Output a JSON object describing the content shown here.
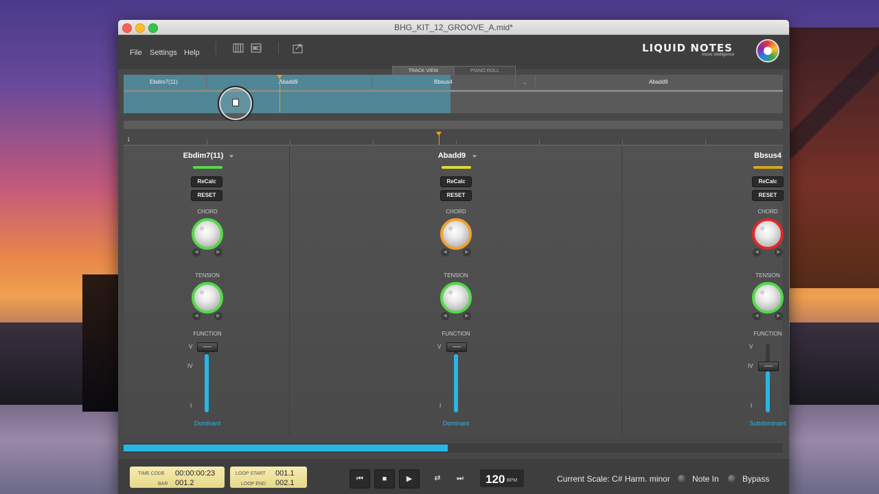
{
  "window": {
    "title": "BHG_KIT_12_GROOVE_A.mid*"
  },
  "menu": {
    "file": "File",
    "settings": "Settings",
    "help": "Help"
  },
  "toolbar": {
    "icons": [
      "piano-icon",
      "grid-icon",
      "export-icon"
    ]
  },
  "logo": {
    "name": "LIQUID NOTES",
    "tagline": "music intelligence"
  },
  "tabs": {
    "track_view": "TRACK VIEW",
    "piano_roll": "PIANO ROLL"
  },
  "track": {
    "segments": [
      "Ebdim7(11)",
      "Abadd9",
      "Bbsus4",
      "..",
      "Abadd9"
    ]
  },
  "ruler": {
    "start": "1"
  },
  "channels": [
    {
      "name": "Ebdim7(11)",
      "recalc": "ReCalc",
      "reset": "RESET",
      "chord_label": "CHORD",
      "tension_label": "TENSION",
      "function_label": "FUNCTION",
      "function": "Dominant",
      "fader_level": 0.85,
      "chord_color": "#55d84a",
      "tension_color": "#55d84a",
      "bar_color": "#55d84a"
    },
    {
      "name": "Abadd9",
      "recalc": "ReCalc",
      "reset": "RESET",
      "chord_label": "CHORD",
      "tension_label": "TENSION",
      "function_label": "FUNCTION",
      "function": "Dominant",
      "fader_level": 0.85,
      "chord_color": "#f0a030",
      "tension_color": "#55d84a",
      "bar_color": "#d8e030"
    },
    {
      "name": "Bbsus4",
      "recalc": "ReCalc",
      "reset": "RESET",
      "chord_label": "CHORD",
      "tension_label": "TENSION",
      "function_label": "FUNCTION",
      "function": "Subdominant",
      "fader_level": 0.6,
      "chord_color": "#e02828",
      "tension_color": "#55d84a",
      "bar_color": "#d0a820"
    }
  ],
  "roman": {
    "v": "V",
    "iv": "IV",
    "i": "I"
  },
  "playback_progress": 0.49,
  "transport": {
    "time_code_label": "TIME CODE",
    "time_code": "00:00:00:23",
    "bar_label": "BAR",
    "bar": "001.2",
    "loop_start_label": "LOOP START",
    "loop_start": "001.1",
    "loop_end_label": "LOOP END",
    "loop_end": "002.1",
    "bpm": "120",
    "bpm_unit": "BPM",
    "scale": "Current Scale: C# Harm. minor",
    "note_in": "Note In",
    "bypass": "Bypass"
  },
  "colors": {
    "accent": "#29b6e6",
    "playhead": "#e8a020"
  }
}
